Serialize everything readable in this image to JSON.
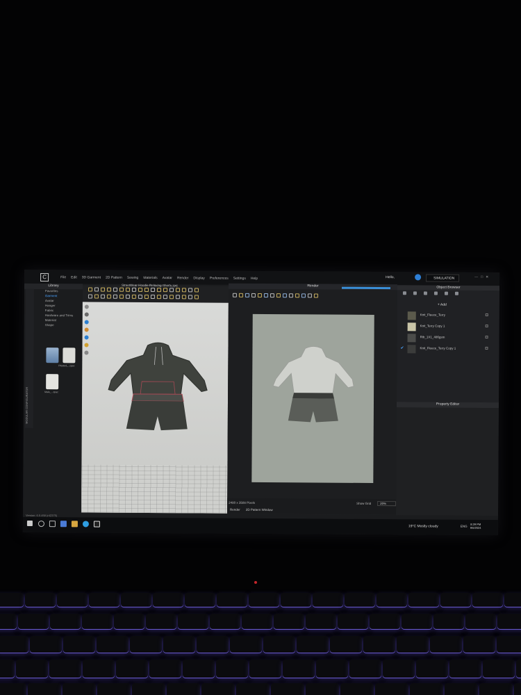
{
  "app": {
    "menu": [
      "File",
      "Edit",
      "3D Garment",
      "2D Pattern",
      "Sewing",
      "Materials",
      "Avatar",
      "Render",
      "Display",
      "Preferences",
      "Settings",
      "Help"
    ],
    "user": "Hello, ",
    "simulation": "SIMULATION",
    "file_name": "StreetWear-Hoodie-Relaxing-Shorts.zprj",
    "version": "Version: 6.0.459 (r42375)"
  },
  "library": {
    "title": "Library",
    "vertical_tabs": "MODULAR CONFIGURATOR",
    "categories": [
      "Favorites",
      "Garment",
      "Avatar",
      "Hanger",
      "Fabric",
      "Hardware and Trims",
      "Material",
      "Shape"
    ],
    "selected": "Garment",
    "thumbs": [
      "Pleated_..zpac",
      "Male_...zpac"
    ]
  },
  "render": {
    "title": "Render",
    "pixels": "2480 x 3508 Pixels",
    "show_grid": "Show Grid",
    "zoom": "20%",
    "tabs": [
      "Render",
      "2D Pattern Window"
    ]
  },
  "object_browser": {
    "title": "Object Browser",
    "add": "+ Add",
    "items": [
      {
        "name": "Knit_Fleece_Terry",
        "color": "#5b5a4c",
        "checked": false
      },
      {
        "name": "Knit_Terry Copy 1",
        "color": "#c9c5a8",
        "checked": false
      },
      {
        "name": "Rib_1X1_486gsm",
        "color": "#4b4c4a",
        "checked": false
      },
      {
        "name": "Knit_Fleece_Terry Copy 1",
        "color": "#3b3c3b",
        "checked": true
      }
    ]
  },
  "property_editor": {
    "title": "Property Editor"
  },
  "taskbar": {
    "weather": "19°C  Mostly cloudy",
    "lang": "ENG",
    "time": "8:29 PM",
    "date": "9/6/2024"
  },
  "colors": {
    "accent": "#3a8fd8",
    "garment_left": "#3e413c",
    "garment_render": "#c9cbc6",
    "keyboard_glow": "#7c67ff"
  }
}
